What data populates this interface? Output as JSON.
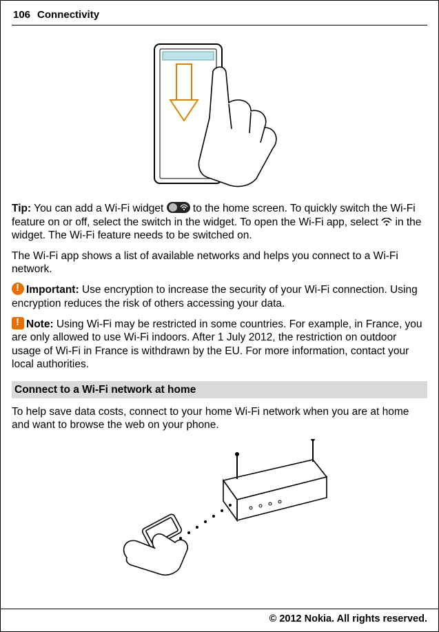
{
  "header": {
    "page_number": "106",
    "section": "Connectivity"
  },
  "body": {
    "tip_label": "Tip:",
    "tip_text_1": " You can add a Wi-Fi widget ",
    "tip_text_2": " to the home screen. To quickly switch the Wi-Fi feature on or off, select the switch in the widget. To open the Wi-Fi app, select ",
    "tip_text_3": " in the widget. The Wi-Fi feature needs to be switched on.",
    "para_app": "The Wi-Fi app shows a list of available networks and helps you connect to a Wi-Fi network.",
    "important_label": "Important:",
    "important_text": " Use encryption to increase the security of your Wi-Fi connection. Using encryption reduces the risk of others accessing your data.",
    "note_label": "Note:",
    "note_text": " Using Wi-Fi may be restricted in some countries. For example, in France, you are only allowed to use Wi-Fi indoors. After 1 July 2012, the restriction on outdoor usage of Wi-Fi in France is withdrawn by the EU. For more information, contact your local authorities.",
    "heading_connect": "Connect to a Wi-Fi network at home",
    "para_connect": "To help save data costs, connect to your home Wi-Fi network when you are at home and want to browse the web on your phone."
  },
  "footer": {
    "copyright": "© 2012 Nokia. All rights reserved."
  }
}
